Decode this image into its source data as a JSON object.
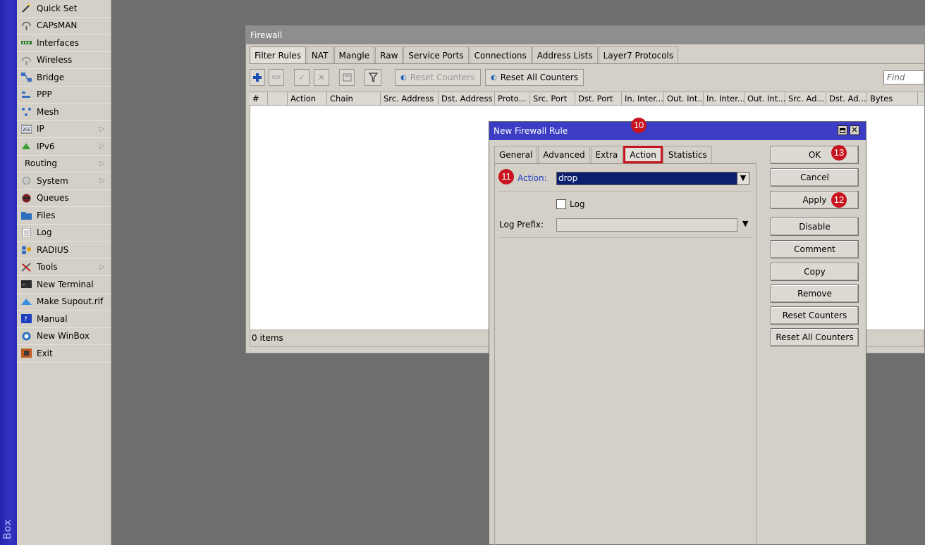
{
  "brand": {
    "strip_text": "Box"
  },
  "sidebar": {
    "items": [
      {
        "label": "Quick Set",
        "icon": "wand-icon",
        "arrow": false
      },
      {
        "label": "CAPsMAN",
        "icon": "antenna-icon",
        "arrow": false
      },
      {
        "label": "Interfaces",
        "icon": "interfaces-icon",
        "arrow": false
      },
      {
        "label": "Wireless",
        "icon": "wireless-icon",
        "arrow": false
      },
      {
        "label": "Bridge",
        "icon": "bridge-icon",
        "arrow": false
      },
      {
        "label": "PPP",
        "icon": "ppp-icon",
        "arrow": false
      },
      {
        "label": "Mesh",
        "icon": "mesh-icon",
        "arrow": false
      },
      {
        "label": "IP",
        "icon": "ip-icon",
        "arrow": true
      },
      {
        "label": "IPv6",
        "icon": "ipv6-icon",
        "arrow": true
      },
      {
        "label": "Routing",
        "icon": "",
        "arrow": true
      },
      {
        "label": "System",
        "icon": "system-icon",
        "arrow": true
      },
      {
        "label": "Queues",
        "icon": "queues-icon",
        "arrow": false
      },
      {
        "label": "Files",
        "icon": "folder-icon",
        "arrow": false
      },
      {
        "label": "Log",
        "icon": "log-icon",
        "arrow": false
      },
      {
        "label": "RADIUS",
        "icon": "radius-icon",
        "arrow": false
      },
      {
        "label": "Tools",
        "icon": "tools-icon",
        "arrow": true
      },
      {
        "label": "New Terminal",
        "icon": "terminal-icon",
        "arrow": false
      },
      {
        "label": "Make Supout.rif",
        "icon": "supout-icon",
        "arrow": false
      },
      {
        "label": "Manual",
        "icon": "manual-icon",
        "arrow": false
      },
      {
        "label": "New WinBox",
        "icon": "winbox-icon",
        "arrow": false
      },
      {
        "label": "Exit",
        "icon": "exit-icon",
        "arrow": false
      }
    ]
  },
  "firewall": {
    "title": "Firewall",
    "tabs": [
      "Filter Rules",
      "NAT",
      "Mangle",
      "Raw",
      "Service Ports",
      "Connections",
      "Address Lists",
      "Layer7 Protocols"
    ],
    "active_tab": "Filter Rules",
    "toolbar": {
      "reset_counters": "Reset Counters",
      "reset_all_counters": "Reset All Counters",
      "find_placeholder": "Find"
    },
    "columns": [
      "#",
      "",
      "Action",
      "Chain",
      "Src. Address",
      "Dst. Address",
      "Proto...",
      "Src. Port",
      "Dst. Port",
      "In. Inter...",
      "Out. Int...",
      "In. Inter...",
      "Out. Int...",
      "Src. Ad...",
      "Dst. Ad...",
      "Bytes"
    ],
    "status": "0 items"
  },
  "dialog": {
    "title": "New Firewall Rule",
    "tabs": [
      "General",
      "Advanced",
      "Extra",
      "Action",
      "Statistics"
    ],
    "active_tab": "Action",
    "action_label": "Action:",
    "action_value": "drop",
    "log_label": "Log",
    "log_checked": false,
    "log_prefix_label": "Log Prefix:",
    "log_prefix_value": "",
    "buttons": [
      "OK",
      "Cancel",
      "Apply",
      "Disable",
      "Comment",
      "Copy",
      "Remove",
      "Reset Counters",
      "Reset All Counters"
    ]
  },
  "badges": {
    "tab": "10",
    "action": "11",
    "apply": "12",
    "ok": "13"
  },
  "colors": {
    "accent_red": "#c8141e",
    "dialog_title": "#3c3cc4",
    "brand_blue": "#2a2ab6"
  }
}
